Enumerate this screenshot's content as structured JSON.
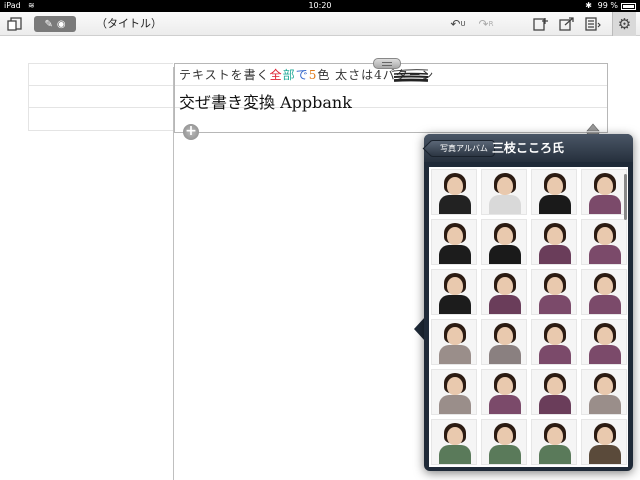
{
  "statusbar": {
    "carrier": "iPad",
    "time": "10:20",
    "battery": "99 %",
    "bluetooth": "✱"
  },
  "toolbar": {
    "title": "（タイトル）",
    "undo_sub": "U",
    "redo_sub": "R"
  },
  "note": {
    "handwriting": {
      "part1": "テキストを書く",
      "part2": "全",
      "part3": "部",
      "part4": "で",
      "part5": "5",
      "part6": "色 太さは4パターン"
    },
    "typed_text": "交ぜ書き変換 Appbank"
  },
  "popover": {
    "back_label": "写真アルバム",
    "title": "三枝こころ氏",
    "photos": [
      {
        "shirt": "#222222"
      },
      {
        "shirt": "#d9d9d9"
      },
      {
        "shirt": "#1a1a1a"
      },
      {
        "shirt": "#7b4a6a"
      },
      {
        "shirt": "#1c1c1c"
      },
      {
        "shirt": "#1a1a1a"
      },
      {
        "shirt": "#6a3d5a"
      },
      {
        "shirt": "#7b4a6a"
      },
      {
        "shirt": "#1c1c1c"
      },
      {
        "shirt": "#6a3d5a"
      },
      {
        "shirt": "#7b4a6a"
      },
      {
        "shirt": "#7b4a6a"
      },
      {
        "shirt": "#9a8e8a"
      },
      {
        "shirt": "#8a8080"
      },
      {
        "shirt": "#7b4a6a"
      },
      {
        "shirt": "#7b4a6a"
      },
      {
        "shirt": "#9a8e8a"
      },
      {
        "shirt": "#7b4a6a"
      },
      {
        "shirt": "#6a3d5a"
      },
      {
        "shirt": "#9a8e8a"
      },
      {
        "shirt": "#5a7a5a"
      },
      {
        "shirt": "#5a7a5a"
      },
      {
        "shirt": "#5a7a5a"
      },
      {
        "shirt": "#5a4a3a"
      }
    ]
  },
  "colors": {
    "toolbar_mode_bg": "#7a7a7a",
    "popover_bg": "#1f2a38"
  }
}
